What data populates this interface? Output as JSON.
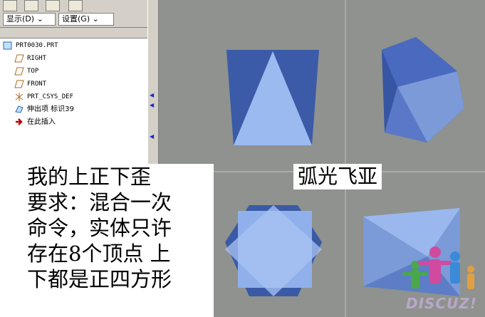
{
  "menu": {
    "display_label": "显示(D)",
    "settings_label": "设置(G)"
  },
  "tree": [
    {
      "label": "PRT0030.PRT",
      "icon": "part-icon"
    },
    {
      "label": "RIGHT",
      "icon": "datum-plane-icon"
    },
    {
      "label": "TOP",
      "icon": "datum-plane-icon"
    },
    {
      "label": "FRONT",
      "icon": "datum-plane-icon"
    },
    {
      "label": "PRT_CSYS_DEF",
      "icon": "coordinate-system-icon"
    },
    {
      "label": "伸出项 标识39",
      "icon": "protrusion-icon"
    },
    {
      "label": "在此插入",
      "icon": "insert-here-arrow-icon"
    }
  ],
  "caption": {
    "line1": "我的上正下歪",
    "line2": "要求：混合一次",
    "line3": "命令，实体只许",
    "line4": "存在8个顶点 上",
    "line5": "下都是正四方形"
  },
  "tag": "弧光飞亚",
  "logo_text": "DISCUZ!",
  "colors": {
    "background": "#8f928e",
    "shape_dark": "#3a5aa6",
    "shape_light": "#9ab8ee"
  }
}
